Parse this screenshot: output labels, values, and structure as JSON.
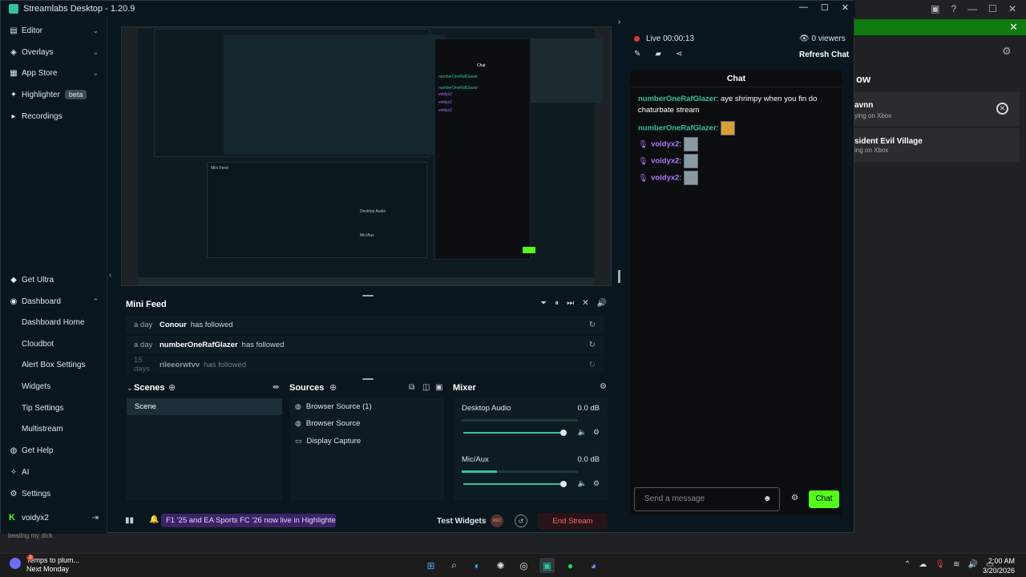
{
  "window": {
    "title": "Streamlabs Desktop - 1.20.9"
  },
  "sidebar": {
    "items": [
      {
        "label": "Editor",
        "icon": "editor-icon"
      },
      {
        "label": "Overlays",
        "icon": "overlays-icon"
      },
      {
        "label": "App Store",
        "icon": "app-store-icon"
      },
      {
        "label": "Highlighter",
        "badge": "beta",
        "icon": "highlighter-icon"
      },
      {
        "label": "Recordings",
        "icon": "recordings-icon"
      }
    ],
    "get_ultra": "Get Ultra",
    "dashboard": "Dashboard",
    "dashboard_items": [
      "Dashboard Home",
      "Cloudbot",
      "Alert Box Settings",
      "Widgets",
      "Tip Settings",
      "Multistream"
    ],
    "get_help": "Get Help",
    "ai": "AI",
    "settings": "Settings",
    "username": "voidyx2"
  },
  "mini_feed": {
    "title": "Mini Feed",
    "rows": [
      {
        "ago": "a day",
        "user": "Conour",
        "action": "has followed"
      },
      {
        "ago": "a day",
        "user": "numberOneRafGlazer",
        "action": "has followed"
      },
      {
        "ago": "15 days",
        "user": "rileeorwtvv",
        "action": "has followed"
      }
    ]
  },
  "scenes": {
    "title": "Scenes",
    "items": [
      "Scene"
    ]
  },
  "sources": {
    "title": "Sources",
    "items": [
      "Browser Source (1)",
      "Browser Source",
      "Display Capture"
    ]
  },
  "mixer": {
    "title": "Mixer",
    "channels": [
      {
        "name": "Desktop Audio",
        "db": "0.0 dB",
        "level": 0.0
      },
      {
        "name": "Mic/Aux",
        "db": "0.0 dB",
        "level": 0.3
      }
    ]
  },
  "bottom_bar": {
    "promo": "F1 '25 and EA Sports FC '26 now live in Highlighter!",
    "test_widgets": "Test Widgets",
    "rec": "REC",
    "end_stream": "End Stream"
  },
  "chat_panel": {
    "live": "Live 00:00:13",
    "viewers": "0 viewers",
    "refresh": "Refresh Chat",
    "header": "Chat",
    "messages": [
      {
        "user": "numberOneRafGlazer",
        "text": "aye shrimpy when you fin do chaturbate stream"
      },
      {
        "user": "numberOneRafGlazer",
        "text": ""
      },
      {
        "user": "voidyx2",
        "text": ""
      },
      {
        "user": "voidyx2",
        "text": ""
      },
      {
        "user": "voidyx2",
        "text": ""
      }
    ],
    "placeholder": "Send a message",
    "send": "Chat"
  },
  "preview": {
    "chat_title": "Chat",
    "mini_feed": "Mini Feed",
    "desktop_audio": "Desktop Audio",
    "mic_aux": "Mic/Aux"
  },
  "background_app": {
    "heading": "ow",
    "cards": [
      {
        "title": "avnn",
        "subtitle": "ying on Xbox"
      },
      {
        "title": "sident Evil Village",
        "subtitle": "ing on Xbox"
      }
    ]
  },
  "taskbar": {
    "weather_line1": "Temps to plum...",
    "weather_line2": "Next Monday",
    "time": "2:00 AM",
    "date": "3/20/2026"
  },
  "ghost_text": "beating my dick",
  "colors": {
    "accent": "#31c3a2",
    "kick_green": "#53fc18",
    "live_red": "#e0392b",
    "chat_purple": "#b176ff"
  }
}
